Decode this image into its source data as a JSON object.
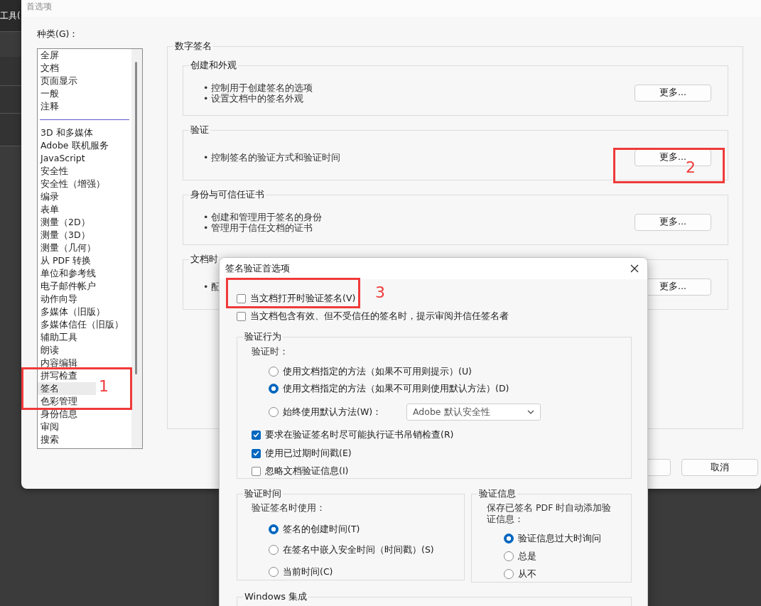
{
  "background_app": {
    "menu_text": "工具("
  },
  "preferences": {
    "title": "首选项",
    "category_label": "种类(G)：",
    "category_groups": [
      [
        {
          "label": "全屏",
          "selected": false
        },
        {
          "label": "文档",
          "selected": false
        },
        {
          "label": "页面显示",
          "selected": false
        },
        {
          "label": "一般",
          "selected": false
        },
        {
          "label": "注释",
          "selected": false
        }
      ],
      [
        {
          "label": "3D 和多媒体",
          "selected": false
        },
        {
          "label": "Adobe 联机服务",
          "selected": false
        },
        {
          "label": "JavaScript",
          "selected": false
        },
        {
          "label": "安全性",
          "selected": false
        },
        {
          "label": "安全性（增强）",
          "selected": false
        },
        {
          "label": "编录",
          "selected": false
        },
        {
          "label": "表单",
          "selected": false
        },
        {
          "label": "测量（2D）",
          "selected": false
        },
        {
          "label": "测量（3D）",
          "selected": false
        },
        {
          "label": "测量（几何）",
          "selected": false
        },
        {
          "label": "从 PDF 转换",
          "selected": false
        },
        {
          "label": "单位和参考线",
          "selected": false
        },
        {
          "label": "电子邮件帐户",
          "selected": false
        },
        {
          "label": "动作向导",
          "selected": false
        },
        {
          "label": "多媒体（旧版）",
          "selected": false
        },
        {
          "label": "多媒体信任（旧版）",
          "selected": false
        },
        {
          "label": "辅助工具",
          "selected": false
        },
        {
          "label": "朗读",
          "selected": false
        },
        {
          "label": "内容编辑",
          "selected": false
        },
        {
          "label": "拼写检查",
          "selected": false
        },
        {
          "label": "签名",
          "selected": true
        },
        {
          "label": "色彩管理",
          "selected": false
        },
        {
          "label": "身份信息",
          "selected": false
        },
        {
          "label": "审阅",
          "selected": false
        },
        {
          "label": "搜索",
          "selected": false
        }
      ]
    ],
    "panel": {
      "title": "数字签名",
      "sections": [
        {
          "title": "创建和外观",
          "bullets": [
            "• 控制用于创建签名的选项",
            "• 设置文档中的签名外观"
          ],
          "button": "更多..."
        },
        {
          "title": "验证",
          "bullets": [
            "• 控制签名的验证方式和验证时间"
          ],
          "button": "更多..."
        },
        {
          "title": "身份与可信任证书",
          "bullets": [
            "• 创建和管理用于签名的身份",
            "• 管理用于信任文档的证书"
          ],
          "button": "更多..."
        },
        {
          "title": "文档时",
          "bullets": [
            "• 配"
          ],
          "button": "更多..."
        }
      ]
    },
    "buttons": [
      {
        "label": "取消"
      }
    ]
  },
  "dialog": {
    "title": "签名验证首选项",
    "top_options": [
      {
        "label": "当文档打开时验证签名(V)",
        "checked": false
      },
      {
        "label": "当文档包含有效、但不受信任的签名时，提示审阅并信任签名者",
        "checked": false
      }
    ],
    "behavior": {
      "title": "验证行为",
      "prompt": "验证时：",
      "radios": [
        {
          "label": "使用文档指定的方法（如果不可用则提示）(U)",
          "selected": false
        },
        {
          "label": "使用文档指定的方法（如果不可用则使用默认方法）(D)",
          "selected": true
        },
        {
          "label": "始终使用默认方法(W)：",
          "selected": false
        }
      ],
      "dropdown": {
        "value": "Adobe 默认安全性"
      },
      "checkboxes": [
        {
          "label": "要求在验证签名时尽可能执行证书吊销检查(R)",
          "checked": true
        },
        {
          "label": "使用已过期时间戳(E)",
          "checked": true
        },
        {
          "label": "忽略文档验证信息(I)",
          "checked": false
        }
      ]
    },
    "time": {
      "title": "验证时间",
      "prompt": "验证签名时使用：",
      "radios": [
        {
          "label": "签名的创建时间(T)",
          "selected": true
        },
        {
          "label": "在签名中嵌入安全时间（时间戳）(S)",
          "selected": false
        },
        {
          "label": "当前时间(C)",
          "selected": false
        }
      ]
    },
    "info": {
      "title": "验证信息",
      "prompt": "保存已签名 PDF 时自动添加验证信息：",
      "radios": [
        {
          "label": "验证信息过大时询问",
          "selected": true
        },
        {
          "label": "总是",
          "selected": false
        },
        {
          "label": "从不",
          "selected": false
        }
      ]
    },
    "windows": {
      "title": "Windows 集成"
    }
  },
  "annotations": [
    {
      "label": "1"
    },
    {
      "label": "2"
    },
    {
      "label": "3"
    }
  ]
}
